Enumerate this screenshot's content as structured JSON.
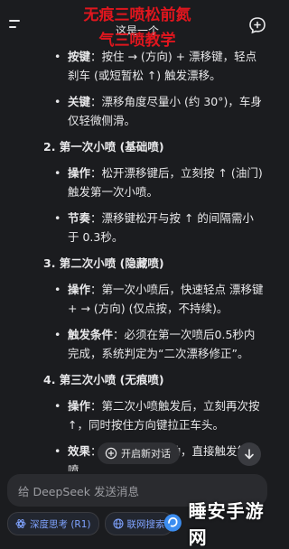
{
  "header": {
    "overlay_line1": "无痕三喷松前氮",
    "subtitle": "这是一个",
    "overlay_line2": "气三喷教学"
  },
  "sections": {
    "intro_bullets": [
      {
        "label": "按键",
        "text": "：按住 → (方向) + 漂移键，轻点刹车 (或短暂松 ↑) 触发漂移。"
      },
      {
        "label": "关键",
        "text": "：漂移角度尽量小 (约 30°)，车身仅轻微侧滑。"
      }
    ],
    "s2_heading": "2. 第一次小喷 (基础喷)",
    "s2_bullets": [
      {
        "label": "操作",
        "text": "：松开漂移键后，立刻按 ↑ (油门) 触发第一次小喷。"
      },
      {
        "label": "节奏",
        "text": "：漂移键松开与按 ↑ 的间隔需小于 0.3秒。"
      }
    ],
    "s3_heading": "3. 第二次小喷 (隐藏喷)",
    "s3_bullets": [
      {
        "label": "操作",
        "text": "：第一次小喷后，快速轻点 漂移键 + → (方向) (仅点按，不持续)。"
      },
      {
        "label": "触发条件",
        "text": "：必须在第一次喷后0.5秒内完成，系统判定为“二次漂移修正”。"
      }
    ],
    "s4_heading": "4. 第三次小喷 (无痕喷)",
    "s4_bullets": [
      {
        "label": "操作",
        "text": "：第二次小喷触发后，立刻再次按 ↑，同时按住方向键拉正车头。"
      },
      {
        "label": "效果",
        "text": "：车身几乎无摆动，直接触发第三喷。"
      }
    ]
  },
  "new_chat_label": "开启新对话",
  "input": {
    "placeholder": "给 DeepSeek 发送消息"
  },
  "chips": [
    {
      "label": "深度思考 (R1)",
      "icon": "atom-icon"
    },
    {
      "label": "联网搜索",
      "icon": "globe-icon"
    }
  ],
  "watermark": {
    "text": "睡安手游网"
  },
  "colors": {
    "background": "#1b1c1f",
    "overlay_red": "#e0161e",
    "chip_blue": "#7fa3ff"
  }
}
